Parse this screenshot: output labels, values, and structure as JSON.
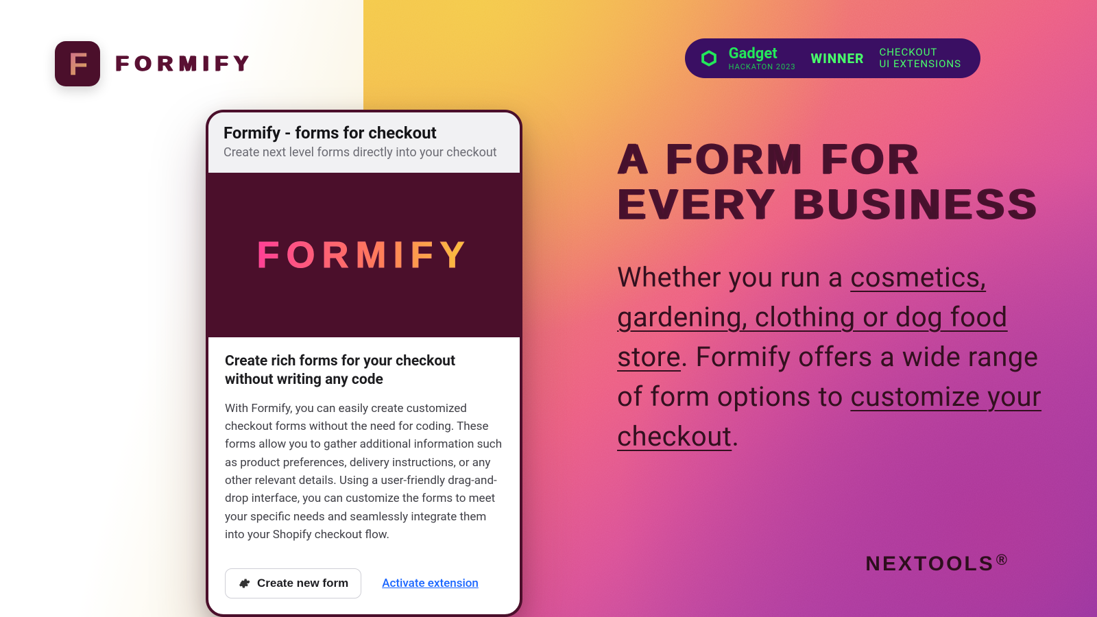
{
  "brand": {
    "word": "FORMIFY",
    "mark": "F"
  },
  "award": {
    "gadget": "Gadget",
    "gadget_sub": "HACKATON 2023",
    "winner": "WINNER",
    "category_l1": "CHECKOUT",
    "category_l2": "UI EXTENSIONS"
  },
  "card": {
    "title": "Formify - forms for checkout",
    "subtitle": "Create next level forms directly into your checkout",
    "hero_word": "FORMIFY",
    "body_heading": "Create rich forms for your checkout without writing any code",
    "body_text": "With Formify, you can easily create customized checkout forms without the need for coding. These forms allow you to gather additional information such as product preferences, delivery instructions, or any other relevant details. Using a user-friendly drag-and-drop interface, you can customize the forms to meet your specific needs and seamlessly integrate them into your Shopify checkout flow.",
    "create_button": "Create new form",
    "activate_link": "Activate extension"
  },
  "copy": {
    "headline_l1": "A FORM FOR",
    "headline_l2": "EVERY BUSINESS",
    "p_pre": "Whether you run a ",
    "p_u1": "cosmetics, gardening, clothing or dog food store",
    "p_mid": ". Formify offers a wide range of form options to ",
    "p_u2": "customize your checkout",
    "p_end": "."
  },
  "footer": {
    "nextools": "NEXTOOLS"
  }
}
